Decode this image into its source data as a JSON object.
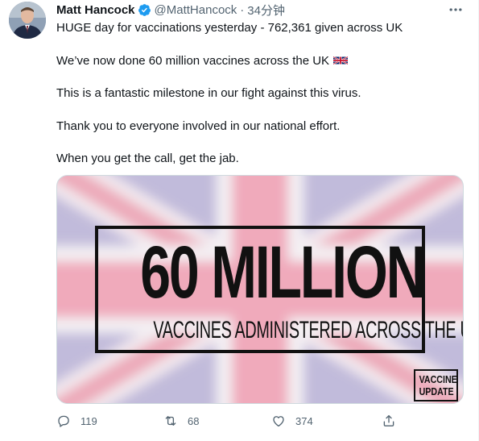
{
  "author": {
    "name": "Matt Hancock",
    "handle": "@MattHancock",
    "separator": "·",
    "time": "34分钟",
    "verified": true
  },
  "tweet": {
    "lines": [
      "HUGE day for vaccinations yesterday - 762,361 given across UK",
      "We’ve now done 60 million vaccines across the UK",
      "This is a fantastic milestone in our fight against this virus.",
      "Thank you to everyone involved in our national effort.",
      "When you get the call, get the jab."
    ],
    "emoji": "uk-flag-icon"
  },
  "media": {
    "headline": "60 MILLION",
    "subline": "VACCINES ADMINISTERED ACROSS THE UK",
    "badge_line1": "VACCINE",
    "badge_line2": "UPDATE"
  },
  "actions": {
    "replies": "119",
    "retweets": "68",
    "likes": "374"
  },
  "colors": {
    "text": "#0f1419",
    "secondary": "#536471",
    "verified": "#1d9bf0"
  }
}
